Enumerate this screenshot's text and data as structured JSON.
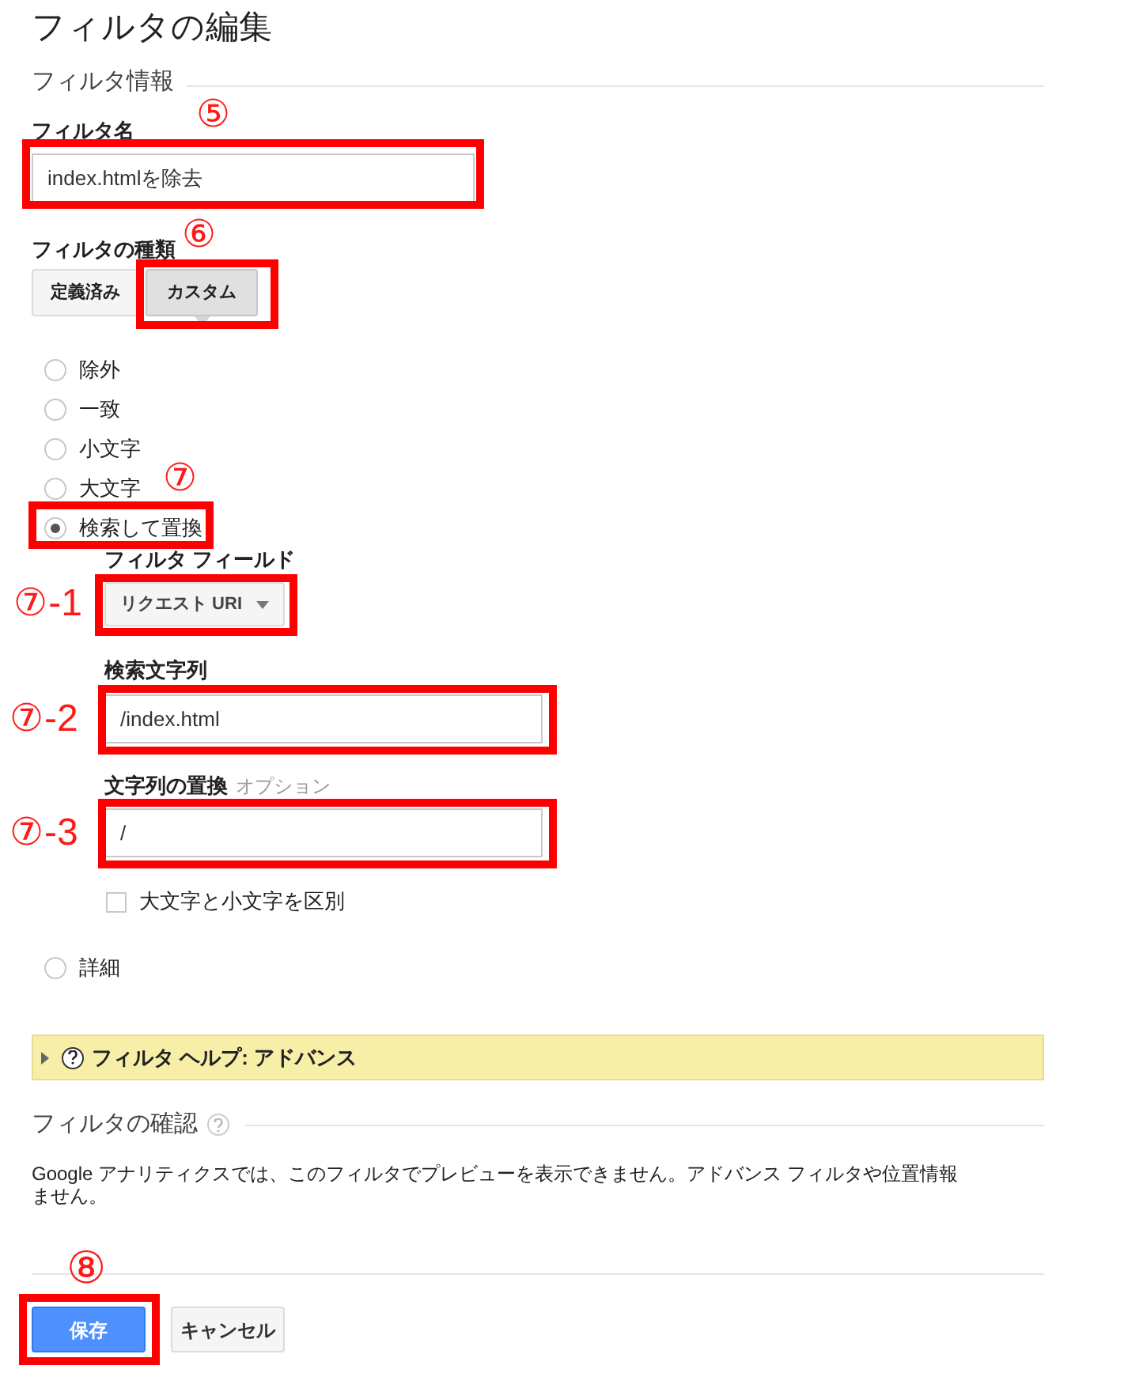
{
  "title": "フィルタの編集",
  "filter_info": {
    "heading": "フィルタ情報",
    "name_label": "フィルタ名",
    "name_marker": "⑤",
    "name_value": "index.htmlを除去",
    "name_highlighted": true
  },
  "filter_type": {
    "label": "フィルタの種類",
    "marker": "⑥",
    "buttons": [
      {
        "label": "定義済み",
        "selected": false,
        "highlighted": false
      },
      {
        "label": "カスタム",
        "selected": true,
        "highlighted": true
      }
    ]
  },
  "options": [
    {
      "label": "除外",
      "selected": false,
      "highlighted": false
    },
    {
      "label": "一致",
      "selected": false,
      "highlighted": false
    },
    {
      "label": "小文字",
      "selected": false,
      "highlighted": false
    },
    {
      "label": "大文字",
      "selected": false,
      "highlighted": false,
      "marker": "⑦"
    },
    {
      "label": "検索して置換",
      "selected": true,
      "highlighted": true
    }
  ],
  "search_replace": {
    "field_label": "フィルタ フィールド",
    "field_marker": "⑦-1",
    "field_value": "リクエスト URI",
    "search_label": "検索文字列",
    "search_marker": "⑦-2",
    "search_value": "/index.html",
    "replace_label": "文字列の置換",
    "replace_hint": "オプション",
    "replace_marker": "⑦-3",
    "replace_value": "/",
    "case_label": "大文字と小文字を区別",
    "case_checked": false
  },
  "advanced_option": {
    "label": "詳細",
    "selected": false
  },
  "help_bar": {
    "label": "フィルタ ヘルプ: アドバンス",
    "expanded": false
  },
  "verify": {
    "heading": "フィルタの確認",
    "lines": [
      "Google アナリティクスでは、このフィルタでプレビューを表示できません。アドバンス フィルタや位置情報",
      "ません。"
    ]
  },
  "save_marker": "⑧",
  "buttons": [
    {
      "label": "保存",
      "kind": "primary"
    },
    {
      "label": "キャンセル",
      "kind": "secondary"
    }
  ]
}
